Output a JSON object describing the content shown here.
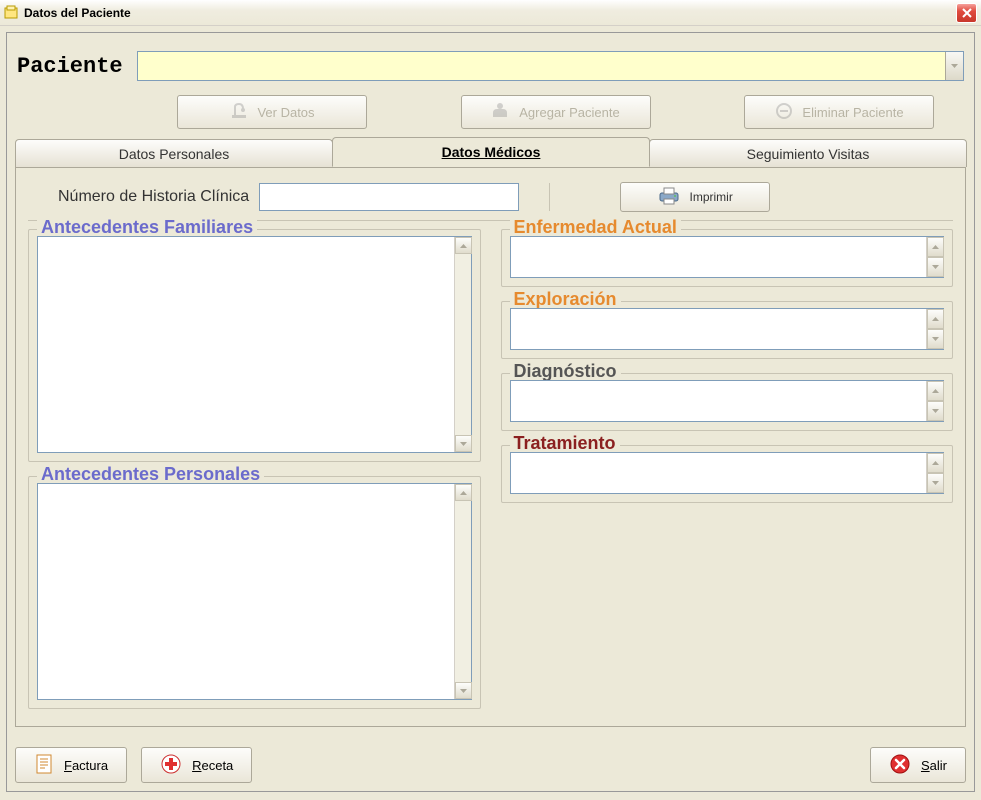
{
  "window": {
    "title": "Datos del Paciente"
  },
  "paciente": {
    "label": "Paciente",
    "value": ""
  },
  "topButtons": {
    "ver": "Ver Datos",
    "agregar": "Agregar Paciente",
    "eliminar": "Eliminar Paciente"
  },
  "tabs": {
    "personales": "Datos Personales",
    "medicos": "Datos Médicos",
    "visitas": "Seguimiento Visitas",
    "active": "medicos"
  },
  "historia": {
    "label": "Número de Historia Clínica",
    "value": ""
  },
  "imprimir": "Imprimir",
  "groups": {
    "antecedentes_familiares": {
      "title": "Antecedentes Familiares",
      "value": ""
    },
    "antecedentes_personales": {
      "title": "Antecedentes Personales",
      "value": ""
    },
    "enfermedad_actual": {
      "title": "Enfermedad Actual",
      "value": ""
    },
    "exploracion": {
      "title": "Exploración",
      "value": ""
    },
    "diagnostico": {
      "title": "Diagnóstico",
      "value": ""
    },
    "tratamiento": {
      "title": "Tratamiento",
      "value": ""
    }
  },
  "bottom": {
    "factura": "Factura",
    "receta": "Receta",
    "salir": "Salir"
  },
  "colors": {
    "legend_purple": "#6b6bcc",
    "legend_orange": "#e68a2e",
    "legend_gray": "#555555",
    "legend_darkred": "#8b2020",
    "paciente_bg": "#ffffcc"
  }
}
